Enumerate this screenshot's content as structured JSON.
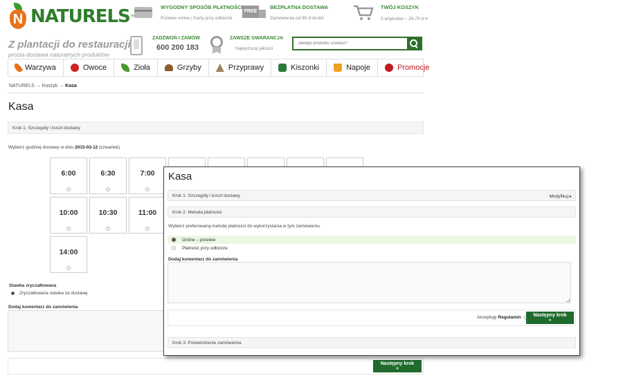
{
  "header": {
    "logo": {
      "letter": "N",
      "name": "NATURELS",
      "tm": "™"
    },
    "features": {
      "payment": {
        "title": "WYGODNY SPOSÓB PŁATNOŚCI",
        "subtitle": "Przelew online | Karty przy odbiorze"
      },
      "delivery": {
        "title": "BEZPŁATNA DOSTAWA",
        "subtitle": "Zamówienia od 99 zł brutto",
        "badge": "FREE"
      },
      "cart": {
        "title": "TWÓJ KOSZYK",
        "subtitle": "5 artykułów – 29,79 zł ▾"
      }
    },
    "tagline": {
      "main": "Z plantacji do restauracji",
      "sub": "prosta dostawa naturalnych produktów"
    },
    "call": {
      "title": "ZADZWOŃ I ZAMÓW",
      "number": "600 200 183"
    },
    "guarantee": {
      "title": "ZAWSZE GWARANCJA",
      "subtitle": "Najwyższej jakości"
    },
    "search": {
      "placeholder": "Jakiego produktu szukasz?"
    }
  },
  "nav": {
    "items": [
      {
        "label": "Warzywa",
        "icon": "carrot-icon",
        "color": "#e8731a"
      },
      {
        "label": "Owoce",
        "icon": "apple-icon",
        "color": "#d21f1f"
      },
      {
        "label": "Zioła",
        "icon": "herb-icon",
        "color": "#4a9b2e"
      },
      {
        "label": "Grzyby",
        "icon": "mushroom-icon",
        "color": "#8a5a2b"
      },
      {
        "label": "Przyprawy",
        "icon": "spice-icon",
        "color": "#a08060"
      },
      {
        "label": "Kiszonki",
        "icon": "jar-icon",
        "color": "#2a7a3a"
      },
      {
        "label": "Napoje",
        "icon": "drink-icon",
        "color": "#f0a020"
      },
      {
        "label": "Promocje",
        "icon": "promo-icon",
        "color": "#c0191f"
      }
    ]
  },
  "breadcrumb": {
    "home": "NATURELS",
    "cart": "Koszyk",
    "current": "Kasa",
    "sep": " → "
  },
  "background": {
    "title": "Kasa",
    "step1": "Krok 1: Szczegóły i koszt dostawy",
    "choose_prefix": "Wybierz godzinę dostawy w dniu ",
    "choose_date": "2015-03-12",
    "choose_suffix": " (czwartek)",
    "slots": [
      "6:00",
      "6:30",
      "7:00",
      "",
      "",
      "",
      "",
      "",
      "10:00",
      "10:30",
      "11:00",
      "14:00"
    ],
    "rate_title": "Stawka zryczałtowana",
    "rate_option": "Zryczałtowana stawka za dostawę",
    "comment_title": "Dodaj komentarz do zamówienia",
    "next": "Następny krok »"
  },
  "panel": {
    "title": "Kasa",
    "step1": "Krok 1: Szczegóły i koszt dostawy",
    "modify": "Modyfikuj ▸",
    "step2": "Krok 2: Metoda płatności",
    "choose": "Wybierz preferowaną metodę płatności do wykorzystania w tym zamówieniu.",
    "options": [
      "Online – przelew",
      "Płatność przy odbiorze"
    ],
    "comment_title": "Dodaj komentarz do zamówienia",
    "accept": "Akceptuję",
    "terms": "Regulamin",
    "next": "Następny krok »",
    "step3": "Krok 3: Potwierdzenie zamówienia"
  }
}
